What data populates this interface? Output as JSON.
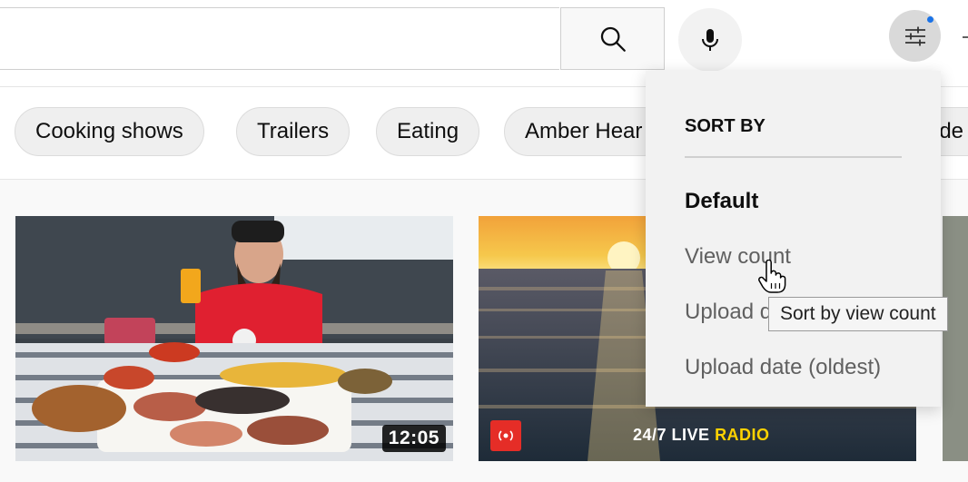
{
  "header": {
    "search_value": "",
    "search_icon": "search-icon",
    "mic_icon": "microphone-icon",
    "filter_icon": "filter-sliders-icon"
  },
  "chips": [
    {
      "label": "Cooking shows"
    },
    {
      "label": "Trailers"
    },
    {
      "label": "Eating"
    },
    {
      "label": "Amber Hear"
    },
    {
      "label": "t de"
    }
  ],
  "sort_menu": {
    "heading": "SORT BY",
    "options": [
      {
        "label": "Default",
        "active": true
      },
      {
        "label": "View count",
        "active": false
      },
      {
        "label": "Upload d",
        "active": false
      },
      {
        "label": "Upload date (oldest)",
        "active": false
      }
    ]
  },
  "tooltip": {
    "text": "Sort by view count"
  },
  "videos": [
    {
      "duration": "12:05"
    },
    {
      "live_label": "24/7 LIVE",
      "live_accent": "RADIO"
    }
  ],
  "colors": {
    "accent_blue": "#1a73e8",
    "live_red": "#e52d27",
    "radio_yellow": "#ffd200"
  }
}
